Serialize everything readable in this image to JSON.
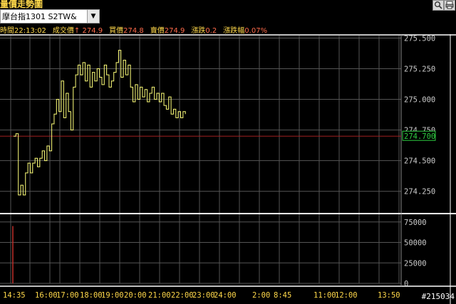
{
  "window": {
    "title": "量價走勢圖"
  },
  "toolbar_icons": [
    "magnifier-icon",
    "print-icon"
  ],
  "selector": {
    "value": "摩台指1301   S2TW&",
    "dropdown_icon": "▼"
  },
  "quote": [
    {
      "label": "時間",
      "value": "22:13:02",
      "label_color": "#ffd84a",
      "value_color": "#ffd84a"
    },
    {
      "label": "成交價",
      "value": "↑ 274.9",
      "label_color": "#ffd84a",
      "value_color": "#ff6b4a"
    },
    {
      "label": "買價",
      "value": "274.8",
      "label_color": "#ffd84a",
      "value_color": "#ff6b4a"
    },
    {
      "label": "賣價",
      "value": "274.9",
      "label_color": "#ffd84a",
      "value_color": "#ff6b4a"
    },
    {
      "label": "漲跌",
      "value": "0.2",
      "label_color": "#ffd84a",
      "value_color": "#ff6b4a"
    },
    {
      "label": "漲跌幅",
      "value": "0.07%",
      "label_color": "#ffd84a",
      "value_color": "#ff6b4a"
    }
  ],
  "watermark": "#215034",
  "colors": {
    "price_line": "#ffff7a",
    "reference_line": "#a02020",
    "grid": "#555555",
    "axis_text": "#cccccc",
    "time_text": "#ffd84a",
    "current_price_box": "#2ecc40",
    "volume_bar": "#c0302a"
  },
  "chart_data": {
    "type": "line",
    "price_axis": {
      "ticks": [
        "275.500",
        "275.250",
        "275.000",
        "274.750",
        "274.500",
        "274.250"
      ],
      "ylim": [
        274.08,
        275.52
      ]
    },
    "reference_price": 274.7,
    "current_price_label": "274.700",
    "volume_axis": {
      "ticks": [
        "75000",
        "50000",
        "25000",
        "0"
      ],
      "ylim": [
        0,
        80000
      ]
    },
    "time_labels": [
      "14:35",
      "16:00",
      "17:00",
      "18:00",
      "19:00",
      "20:00",
      "21:00",
      "22:00",
      "23:00",
      "24:00",
      "2:00",
      "8:45",
      "11:00",
      "12:00",
      "13:50"
    ],
    "volume_series": [
      {
        "slot": 3,
        "value": 70000
      }
    ],
    "price_series": [
      [
        0,
        274.7
      ],
      [
        1,
        274.72
      ],
      [
        2,
        274.22
      ],
      [
        3,
        274.3
      ],
      [
        4,
        274.22
      ],
      [
        5,
        274.4
      ],
      [
        6,
        274.48
      ],
      [
        7,
        274.4
      ],
      [
        8,
        274.48
      ],
      [
        9,
        274.52
      ],
      [
        10,
        274.45
      ],
      [
        11,
        274.52
      ],
      [
        12,
        274.58
      ],
      [
        13,
        274.5
      ],
      [
        14,
        274.62
      ],
      [
        15,
        274.58
      ],
      [
        16,
        274.8
      ],
      [
        17,
        274.88
      ],
      [
        18,
        275.0
      ],
      [
        19,
        274.9
      ],
      [
        20,
        275.15
      ],
      [
        21,
        274.85
      ],
      [
        22,
        275.05
      ],
      [
        23,
        274.9
      ],
      [
        24,
        274.75
      ],
      [
        25,
        275.1
      ],
      [
        26,
        275.2
      ],
      [
        27,
        275.28
      ],
      [
        28,
        275.2
      ],
      [
        29,
        275.3
      ],
      [
        30,
        275.15
      ],
      [
        31,
        275.28
      ],
      [
        32,
        275.1
      ],
      [
        33,
        275.22
      ],
      [
        34,
        275.15
      ],
      [
        35,
        275.25
      ],
      [
        36,
        275.18
      ],
      [
        37,
        275.12
      ],
      [
        38,
        275.28
      ],
      [
        39,
        275.2
      ],
      [
        40,
        275.1
      ],
      [
        41,
        275.15
      ],
      [
        42,
        275.22
      ],
      [
        43,
        275.3
      ],
      [
        44,
        275.4
      ],
      [
        45,
        275.18
      ],
      [
        46,
        275.32
      ],
      [
        47,
        275.2
      ],
      [
        48,
        275.28
      ],
      [
        49,
        275.1
      ],
      [
        50,
        274.98
      ],
      [
        51,
        275.12
      ],
      [
        52,
        275.0
      ],
      [
        53,
        275.1
      ],
      [
        54,
        275.02
      ],
      [
        55,
        275.08
      ],
      [
        56,
        274.98
      ],
      [
        57,
        275.05
      ],
      [
        58,
        275.1
      ],
      [
        59,
        275.0
      ],
      [
        60,
        275.05
      ],
      [
        61,
        274.98
      ],
      [
        62,
        275.05
      ],
      [
        63,
        274.95
      ],
      [
        64,
        274.92
      ],
      [
        65,
        275.02
      ],
      [
        66,
        274.88
      ],
      [
        67,
        274.92
      ],
      [
        68,
        274.85
      ],
      [
        69,
        274.9
      ],
      [
        70,
        274.85
      ],
      [
        71,
        274.9
      ],
      [
        72,
        274.88
      ]
    ]
  }
}
